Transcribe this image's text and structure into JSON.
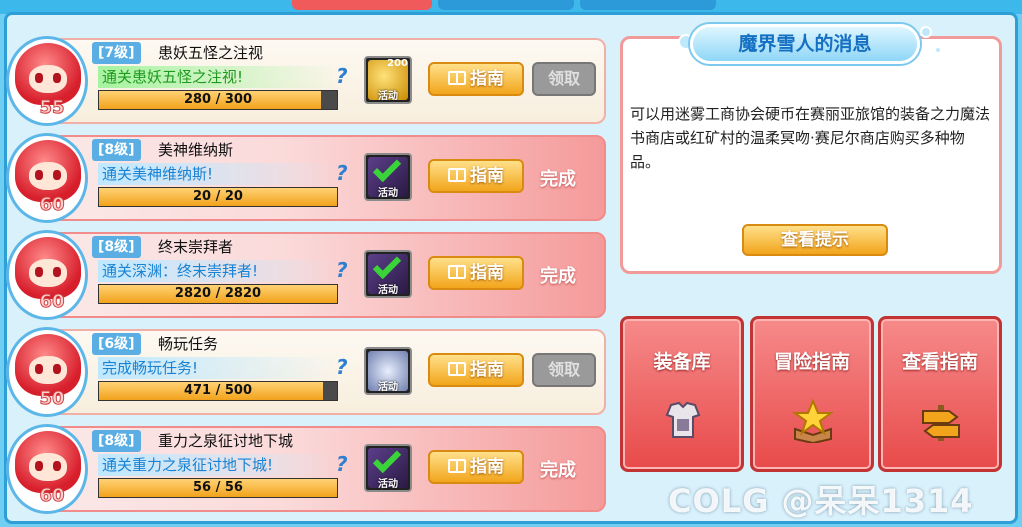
{
  "quests": [
    {
      "level_tag": "[7级]",
      "title": "患妖五怪之注视",
      "desc": "通关患妖五怪之注视!",
      "desc_style": "green",
      "current": 280,
      "total": 300,
      "progress_text": "280 / 300",
      "char_level": "55",
      "reward_icon": "gold-reward-icon",
      "reward_count": "200",
      "reward_tag": "活动",
      "guide_label": "指南",
      "action": "领取",
      "action_type": "claim-disabled",
      "state": "normal",
      "help": "?"
    },
    {
      "level_tag": "[8级]",
      "title": "美神维纳斯",
      "desc": "通关美神维纳斯!",
      "desc_style": "blue",
      "current": 20,
      "total": 20,
      "progress_text": "20 / 20",
      "char_level": "60",
      "reward_icon": "completed-check-icon",
      "reward_count": "",
      "reward_tag": "活动",
      "guide_label": "指南",
      "action": "完成",
      "action_type": "done",
      "state": "done",
      "help": "?"
    },
    {
      "level_tag": "[8级]",
      "title": "终末崇拜者",
      "desc": "通关深渊：终末崇拜者!",
      "desc_style": "blue",
      "current": 2820,
      "total": 2820,
      "progress_text": "2820 / 2820",
      "char_level": "60",
      "reward_icon": "completed-check-icon",
      "reward_count": "",
      "reward_tag": "活动",
      "guide_label": "指南",
      "action": "完成",
      "action_type": "done",
      "state": "done",
      "help": "?"
    },
    {
      "level_tag": "[6级]",
      "title": "畅玩任务",
      "desc": "完成畅玩任务!",
      "desc_style": "blue",
      "current": 471,
      "total": 500,
      "progress_text": "471 / 500",
      "char_level": "50",
      "reward_icon": "gear-reward-icon",
      "reward_count": "",
      "reward_tag": "活动",
      "guide_label": "指南",
      "action": "领取",
      "action_type": "claim-disabled",
      "state": "normal",
      "help": "?"
    },
    {
      "level_tag": "[8级]",
      "title": "重力之泉征讨地下城",
      "desc": "通关重力之泉征讨地下城!",
      "desc_style": "blue",
      "current": 56,
      "total": 56,
      "progress_text": "56 / 56",
      "char_level": "60",
      "reward_icon": "completed-check-icon",
      "reward_count": "",
      "reward_tag": "活动",
      "guide_label": "指南",
      "action": "完成",
      "action_type": "done",
      "state": "done",
      "help": "?"
    }
  ],
  "message": {
    "title": "魔界雪人的消息",
    "body": "可以用迷雾工商协会硬币在赛丽亚旅馆的装备之力魔法书商店或红矿村的温柔冥吻·赛尼尔商店购买多种物品。",
    "hint_button": "查看提示"
  },
  "buttons": {
    "equipment": "装备库",
    "adventure_guide": "冒险指南",
    "view_guide": "查看指南"
  },
  "watermark": "COLG @呆呆1314",
  "colors": {
    "accent": "#2e9fd6",
    "guide": "#f2a51c",
    "done": "#f59a9a",
    "message_border": "#f19a9a"
  }
}
